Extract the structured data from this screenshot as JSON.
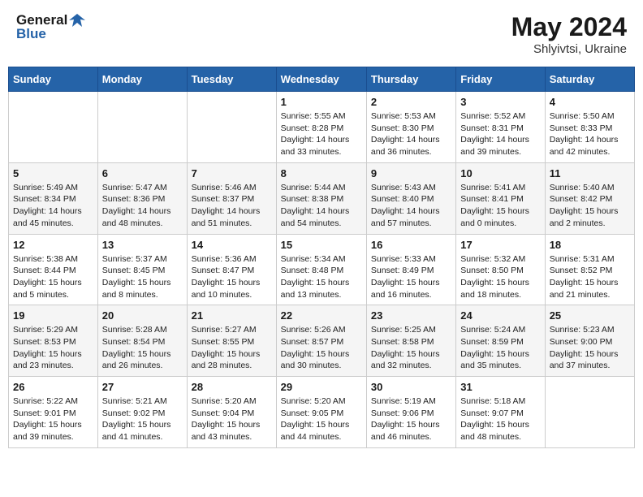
{
  "header": {
    "logo_line1": "General",
    "logo_line2": "Blue",
    "month": "May 2024",
    "location": "Shlyivtsi, Ukraine"
  },
  "days_of_week": [
    "Sunday",
    "Monday",
    "Tuesday",
    "Wednesday",
    "Thursday",
    "Friday",
    "Saturday"
  ],
  "weeks": [
    [
      {
        "day": "",
        "info": ""
      },
      {
        "day": "",
        "info": ""
      },
      {
        "day": "",
        "info": ""
      },
      {
        "day": "1",
        "info": "Sunrise: 5:55 AM\nSunset: 8:28 PM\nDaylight: 14 hours\nand 33 minutes."
      },
      {
        "day": "2",
        "info": "Sunrise: 5:53 AM\nSunset: 8:30 PM\nDaylight: 14 hours\nand 36 minutes."
      },
      {
        "day": "3",
        "info": "Sunrise: 5:52 AM\nSunset: 8:31 PM\nDaylight: 14 hours\nand 39 minutes."
      },
      {
        "day": "4",
        "info": "Sunrise: 5:50 AM\nSunset: 8:33 PM\nDaylight: 14 hours\nand 42 minutes."
      }
    ],
    [
      {
        "day": "5",
        "info": "Sunrise: 5:49 AM\nSunset: 8:34 PM\nDaylight: 14 hours\nand 45 minutes."
      },
      {
        "day": "6",
        "info": "Sunrise: 5:47 AM\nSunset: 8:36 PM\nDaylight: 14 hours\nand 48 minutes."
      },
      {
        "day": "7",
        "info": "Sunrise: 5:46 AM\nSunset: 8:37 PM\nDaylight: 14 hours\nand 51 minutes."
      },
      {
        "day": "8",
        "info": "Sunrise: 5:44 AM\nSunset: 8:38 PM\nDaylight: 14 hours\nand 54 minutes."
      },
      {
        "day": "9",
        "info": "Sunrise: 5:43 AM\nSunset: 8:40 PM\nDaylight: 14 hours\nand 57 minutes."
      },
      {
        "day": "10",
        "info": "Sunrise: 5:41 AM\nSunset: 8:41 PM\nDaylight: 15 hours\nand 0 minutes."
      },
      {
        "day": "11",
        "info": "Sunrise: 5:40 AM\nSunset: 8:42 PM\nDaylight: 15 hours\nand 2 minutes."
      }
    ],
    [
      {
        "day": "12",
        "info": "Sunrise: 5:38 AM\nSunset: 8:44 PM\nDaylight: 15 hours\nand 5 minutes."
      },
      {
        "day": "13",
        "info": "Sunrise: 5:37 AM\nSunset: 8:45 PM\nDaylight: 15 hours\nand 8 minutes."
      },
      {
        "day": "14",
        "info": "Sunrise: 5:36 AM\nSunset: 8:47 PM\nDaylight: 15 hours\nand 10 minutes."
      },
      {
        "day": "15",
        "info": "Sunrise: 5:34 AM\nSunset: 8:48 PM\nDaylight: 15 hours\nand 13 minutes."
      },
      {
        "day": "16",
        "info": "Sunrise: 5:33 AM\nSunset: 8:49 PM\nDaylight: 15 hours\nand 16 minutes."
      },
      {
        "day": "17",
        "info": "Sunrise: 5:32 AM\nSunset: 8:50 PM\nDaylight: 15 hours\nand 18 minutes."
      },
      {
        "day": "18",
        "info": "Sunrise: 5:31 AM\nSunset: 8:52 PM\nDaylight: 15 hours\nand 21 minutes."
      }
    ],
    [
      {
        "day": "19",
        "info": "Sunrise: 5:29 AM\nSunset: 8:53 PM\nDaylight: 15 hours\nand 23 minutes."
      },
      {
        "day": "20",
        "info": "Sunrise: 5:28 AM\nSunset: 8:54 PM\nDaylight: 15 hours\nand 26 minutes."
      },
      {
        "day": "21",
        "info": "Sunrise: 5:27 AM\nSunset: 8:55 PM\nDaylight: 15 hours\nand 28 minutes."
      },
      {
        "day": "22",
        "info": "Sunrise: 5:26 AM\nSunset: 8:57 PM\nDaylight: 15 hours\nand 30 minutes."
      },
      {
        "day": "23",
        "info": "Sunrise: 5:25 AM\nSunset: 8:58 PM\nDaylight: 15 hours\nand 32 minutes."
      },
      {
        "day": "24",
        "info": "Sunrise: 5:24 AM\nSunset: 8:59 PM\nDaylight: 15 hours\nand 35 minutes."
      },
      {
        "day": "25",
        "info": "Sunrise: 5:23 AM\nSunset: 9:00 PM\nDaylight: 15 hours\nand 37 minutes."
      }
    ],
    [
      {
        "day": "26",
        "info": "Sunrise: 5:22 AM\nSunset: 9:01 PM\nDaylight: 15 hours\nand 39 minutes."
      },
      {
        "day": "27",
        "info": "Sunrise: 5:21 AM\nSunset: 9:02 PM\nDaylight: 15 hours\nand 41 minutes."
      },
      {
        "day": "28",
        "info": "Sunrise: 5:20 AM\nSunset: 9:04 PM\nDaylight: 15 hours\nand 43 minutes."
      },
      {
        "day": "29",
        "info": "Sunrise: 5:20 AM\nSunset: 9:05 PM\nDaylight: 15 hours\nand 44 minutes."
      },
      {
        "day": "30",
        "info": "Sunrise: 5:19 AM\nSunset: 9:06 PM\nDaylight: 15 hours\nand 46 minutes."
      },
      {
        "day": "31",
        "info": "Sunrise: 5:18 AM\nSunset: 9:07 PM\nDaylight: 15 hours\nand 48 minutes."
      },
      {
        "day": "",
        "info": ""
      }
    ]
  ]
}
